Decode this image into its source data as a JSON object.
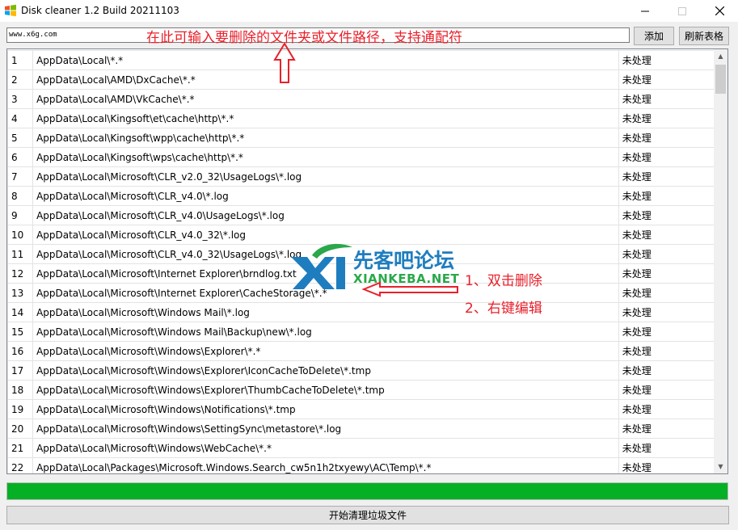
{
  "window": {
    "title": "Disk cleaner 1.2 Build 20211103"
  },
  "input": {
    "value": "www.x6g.com"
  },
  "buttons": {
    "add": "添加",
    "refresh": "刷新表格",
    "start": "开始清理垃圾文件"
  },
  "annotations": {
    "input_hint": "在此可输入要删除的文件夹或文件路径，支持通配符",
    "tip1": "1、双击删除",
    "tip2": "2、右键编辑"
  },
  "watermark": {
    "cn": "先客吧论坛",
    "en": "XIANKEBA.NET"
  },
  "progress": {
    "percent": 100
  },
  "colors": {
    "progress": "#06b025",
    "annotation": "#e8202a"
  },
  "table": {
    "rows": [
      {
        "idx": "1",
        "path": "AppData\\Local\\*.*",
        "status": "未处理"
      },
      {
        "idx": "2",
        "path": "AppData\\Local\\AMD\\DxCache\\*.*",
        "status": "未处理"
      },
      {
        "idx": "3",
        "path": "AppData\\Local\\AMD\\VkCache\\*.*",
        "status": "未处理"
      },
      {
        "idx": "4",
        "path": "AppData\\Local\\Kingsoft\\et\\cache\\http\\*.*",
        "status": "未处理"
      },
      {
        "idx": "5",
        "path": "AppData\\Local\\Kingsoft\\wpp\\cache\\http\\*.*",
        "status": "未处理"
      },
      {
        "idx": "6",
        "path": "AppData\\Local\\Kingsoft\\wps\\cache\\http\\*.*",
        "status": "未处理"
      },
      {
        "idx": "7",
        "path": "AppData\\Local\\Microsoft\\CLR_v2.0_32\\UsageLogs\\*.log",
        "status": "未处理"
      },
      {
        "idx": "8",
        "path": "AppData\\Local\\Microsoft\\CLR_v4.0\\*.log",
        "status": "未处理"
      },
      {
        "idx": "9",
        "path": "AppData\\Local\\Microsoft\\CLR_v4.0\\UsageLogs\\*.log",
        "status": "未处理"
      },
      {
        "idx": "10",
        "path": "AppData\\Local\\Microsoft\\CLR_v4.0_32\\*.log",
        "status": "未处理"
      },
      {
        "idx": "11",
        "path": "AppData\\Local\\Microsoft\\CLR_v4.0_32\\UsageLogs\\*.log",
        "status": "未处理"
      },
      {
        "idx": "12",
        "path": "AppData\\Local\\Microsoft\\Internet Explorer\\brndlog.txt",
        "status": "未处理"
      },
      {
        "idx": "13",
        "path": "AppData\\Local\\Microsoft\\Internet Explorer\\CacheStorage\\*.*",
        "status": "未处理"
      },
      {
        "idx": "14",
        "path": "AppData\\Local\\Microsoft\\Windows Mail\\*.log",
        "status": "未处理"
      },
      {
        "idx": "15",
        "path": "AppData\\Local\\Microsoft\\Windows Mail\\Backup\\new\\*.log",
        "status": "未处理"
      },
      {
        "idx": "16",
        "path": "AppData\\Local\\Microsoft\\Windows\\Explorer\\*.*",
        "status": "未处理"
      },
      {
        "idx": "17",
        "path": "AppData\\Local\\Microsoft\\Windows\\Explorer\\IconCacheToDelete\\*.tmp",
        "status": "未处理"
      },
      {
        "idx": "18",
        "path": "AppData\\Local\\Microsoft\\Windows\\Explorer\\ThumbCacheToDelete\\*.tmp",
        "status": "未处理"
      },
      {
        "idx": "19",
        "path": "AppData\\Local\\Microsoft\\Windows\\Notifications\\*.tmp",
        "status": "未处理"
      },
      {
        "idx": "20",
        "path": "AppData\\Local\\Microsoft\\Windows\\SettingSync\\metastore\\*.log",
        "status": "未处理"
      },
      {
        "idx": "21",
        "path": "AppData\\Local\\Microsoft\\Windows\\WebCache\\*.*",
        "status": "未处理"
      },
      {
        "idx": "22",
        "path": "AppData\\Local\\Packages\\Microsoft.Windows.Search_cw5n1h2txyewy\\AC\\Temp\\*.*",
        "status": "未处理"
      }
    ]
  }
}
